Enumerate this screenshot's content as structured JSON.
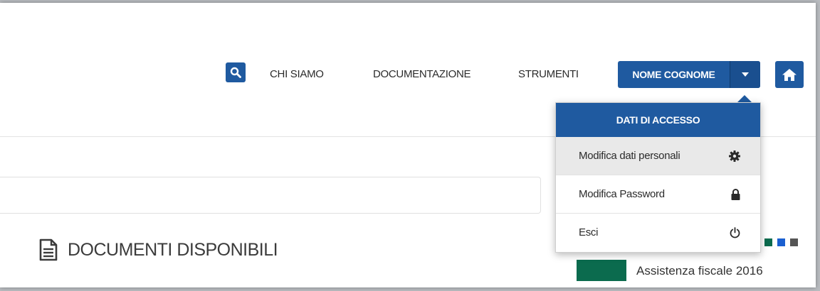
{
  "header": {
    "search_icon": "search-icon",
    "nav": [
      "CHI SIAMO",
      "DOCUMENTAZIONE",
      "STRUMENTI"
    ],
    "user_name": "NOME COGNOME",
    "caret_icon": "caret-down-icon",
    "home_icon": "home-icon"
  },
  "dropdown": {
    "title": "DATI DI ACCESSO",
    "items": [
      {
        "label": "Modifica dati personali",
        "icon": "gear-icon"
      },
      {
        "label": "Modifica Password",
        "icon": "lock-icon"
      },
      {
        "label": "Esci",
        "icon": "power-icon"
      }
    ]
  },
  "main": {
    "title_icon": "document-icon",
    "title": "DOCUMENTI DISPONIBILI",
    "legend_colors": [
      "#b1101f",
      "#0b6b4e",
      "#1a5fd0",
      "#555555"
    ],
    "partial_item": "Assistenza fiscale 2016"
  },
  "colors": {
    "primary": "#1f5aa0",
    "item_green": "#0b6b4e"
  }
}
